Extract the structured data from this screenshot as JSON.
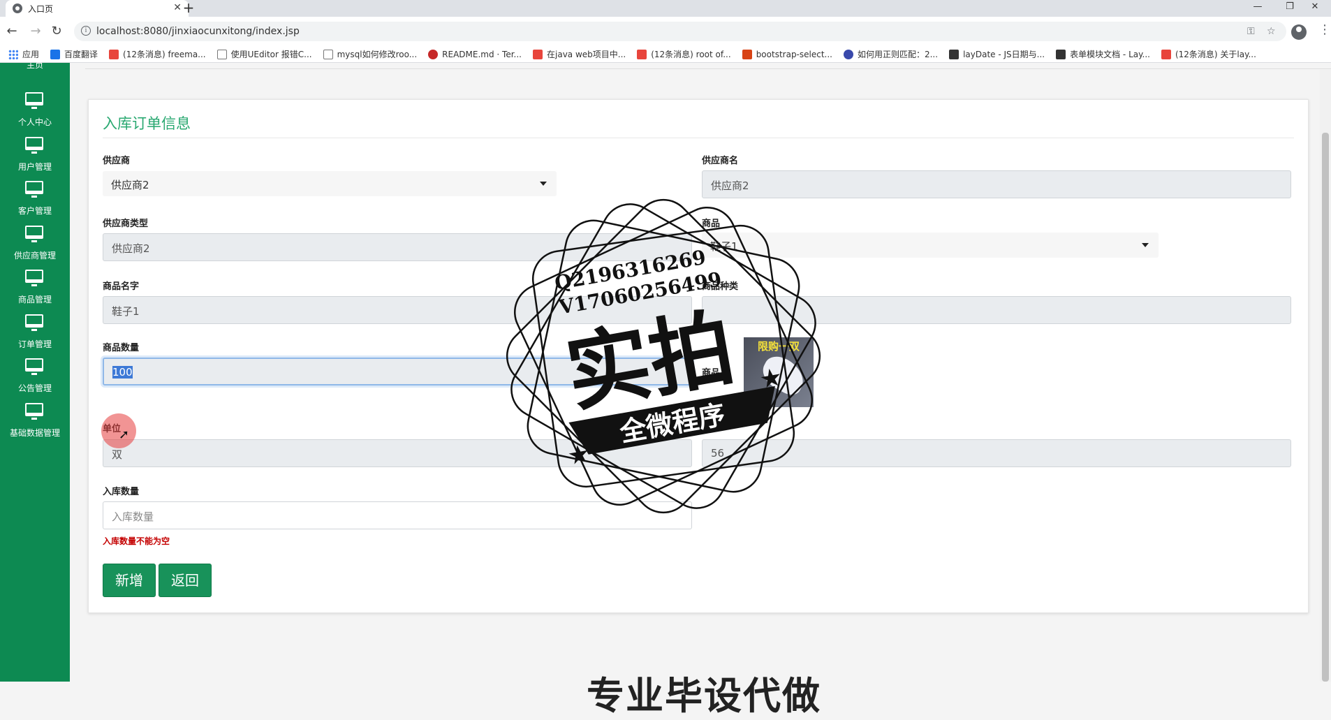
{
  "browser": {
    "tab_title": "入口页",
    "url": "localhost:8080/jinxiaocunxitong/index.jsp",
    "bookmarks": [
      {
        "label": "应用",
        "icon": "apps"
      },
      {
        "label": "百度翻译",
        "icon": "fy"
      },
      {
        "label": "(12条消息) freema...",
        "icon": "c"
      },
      {
        "label": "使用UEditor 报错C...",
        "icon": "mark"
      },
      {
        "label": "mysql如何修改roo...",
        "icon": "mark"
      },
      {
        "label": "README.md · Ter...",
        "icon": "g"
      },
      {
        "label": "在java web项目中...",
        "icon": "c"
      },
      {
        "label": "(12条消息) root of...",
        "icon": "c"
      },
      {
        "label": "bootstrap-select...",
        "icon": "red2"
      },
      {
        "label": "如何用正则匹配：2...",
        "icon": "paw"
      },
      {
        "label": "layDate - JS日期与...",
        "icon": "lay"
      },
      {
        "label": "表单模块文档 - Lay...",
        "icon": "lay"
      },
      {
        "label": "(12条消息) 关于lay...",
        "icon": "c"
      }
    ]
  },
  "sidebar": {
    "partial_top_label": "主页",
    "items": [
      {
        "label": "个人中心"
      },
      {
        "label": "用户管理"
      },
      {
        "label": "客户管理"
      },
      {
        "label": "供应商管理"
      },
      {
        "label": "商品管理"
      },
      {
        "label": "订单管理"
      },
      {
        "label": "公告管理"
      },
      {
        "label": "基础数据管理"
      }
    ]
  },
  "form": {
    "title": "入库订单信息",
    "supplier_label": "供应商",
    "supplier_value": "供应商2",
    "supplier_name_label": "供应商名",
    "supplier_name_value": "供应商2",
    "supplier_type_label": "供应商类型",
    "supplier_type_value": "供应商2",
    "product_label": "商品",
    "product_value": "鞋子1",
    "product_name_label": "商品名字",
    "product_name_value": "鞋子1",
    "product_kind_label": "商品种类",
    "product_kind_value": "",
    "quantity_label": "商品数量",
    "quantity_value": "100",
    "product_image_label": "商品",
    "product_image_caption": "限购一双",
    "unit_label": "单位",
    "unit_value": "双",
    "price_value": "56",
    "inbound_label": "入库数量",
    "inbound_placeholder": "入库数量",
    "inbound_error": "入库数量不能为空",
    "add_button": "新增",
    "back_button": "返回"
  },
  "watermark": {
    "line1": "Q2196316269",
    "line2": "V17060256499",
    "big": "实拍",
    "banner": "全微程序"
  },
  "bottom_text": "专业毕设代做"
}
